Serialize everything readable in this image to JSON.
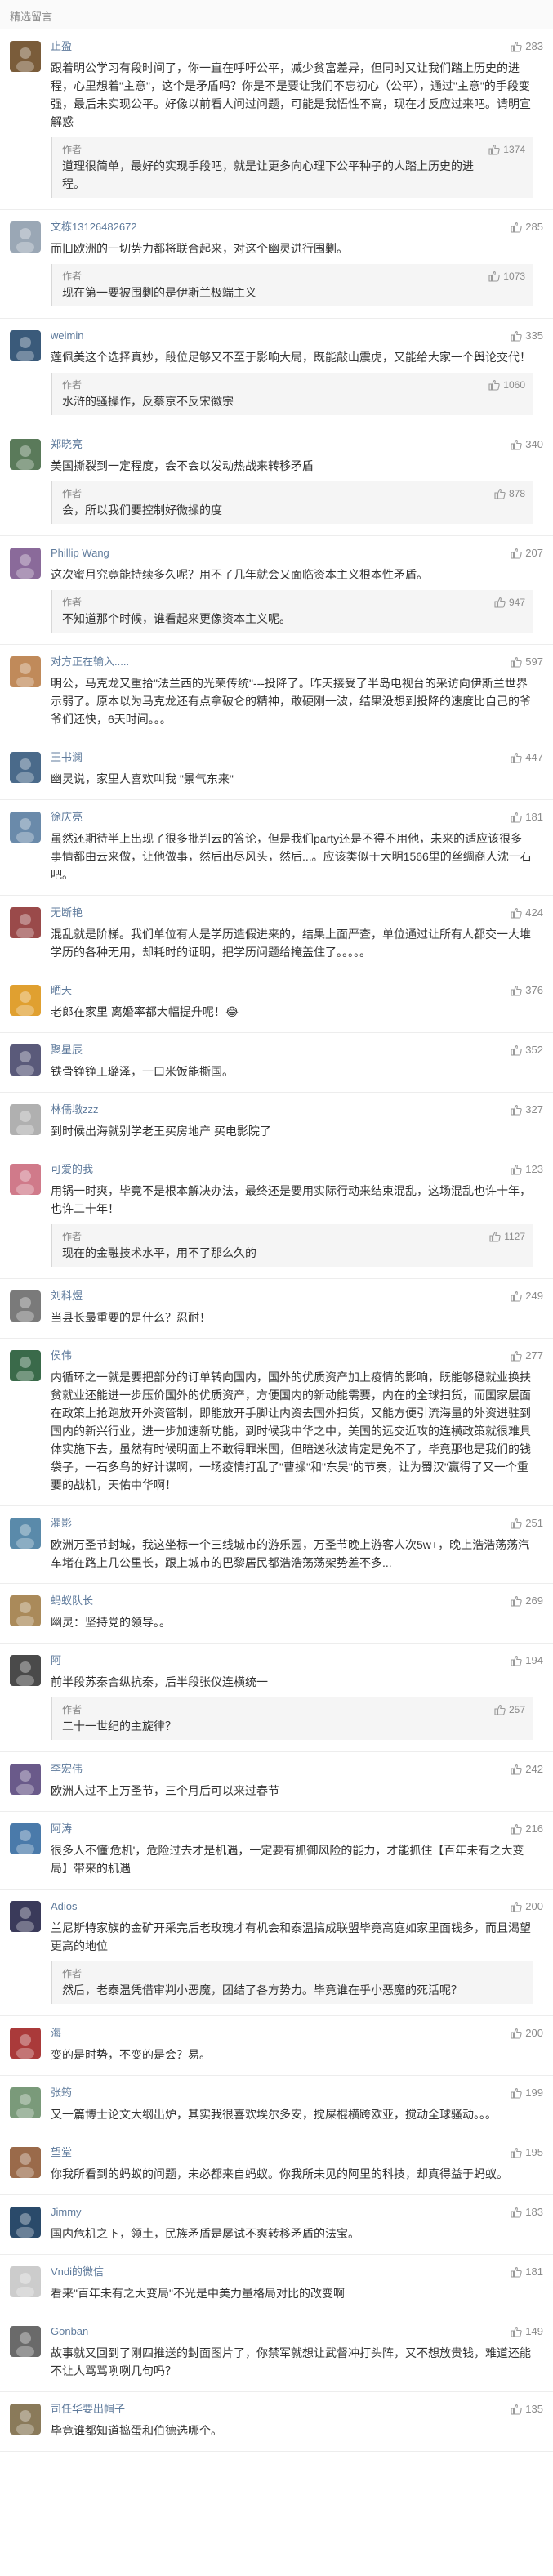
{
  "section_title": "精选留言",
  "author_label": "作者",
  "comments": [
    {
      "name": "止盈",
      "likes": "283",
      "avatar_color": "#7a5c3a",
      "text": "跟着明公学习有段时间了，你一直在呼吁公平，减少贫富差异，但同时又让我们踏上历史的进程，心里想着\"主意\"，这个是矛盾吗？你是不是要让我们不忘初心（公平），通过\"主意\"的手段变强，最后未实现公平。好像以前看人问过问题，可能是我悟性不高，现在才反应过来吧。请明宣解惑",
      "reply": {
        "text": "道理很简单，最好的实现手段吧，就是让更多向心理下公平种子的人踏上历史的进程。",
        "likes": "1374"
      }
    },
    {
      "name": "文栋13126482672",
      "likes": "285",
      "avatar_color": "#9aa7b5",
      "text": "而旧欧洲的一切势力都将联合起来，对这个幽灵进行围剿。",
      "reply": {
        "text": "现在第一要被围剿的是伊斯兰极端主义",
        "likes": "1073"
      }
    },
    {
      "name": "weimin",
      "likes": "335",
      "avatar_color": "#3a5a7a",
      "text": "莲佩美这个选择真妙，段位足够又不至于影响大局，既能敲山震虎，又能给大家一个舆论交代！",
      "reply": {
        "text": "水浒的骚操作，反蔡京不反宋徽宗",
        "likes": "1060"
      }
    },
    {
      "name": "郑晓亮",
      "likes": "340",
      "avatar_color": "#5a7a5a",
      "text": "美国撕裂到一定程度，会不会以发动热战来转移矛盾",
      "reply": {
        "text": "会，所以我们要控制好微操的度",
        "likes": "878"
      }
    },
    {
      "name": "Phillip Wang",
      "likes": "207",
      "avatar_color": "#8a6a9a",
      "text": "这次蜜月究竟能持续多久呢？用不了几年就会又面临资本主义根本性矛盾。",
      "reply": {
        "text": "不知道那个时候，谁看起来更像资本主义呢。",
        "likes": "947"
      }
    },
    {
      "name": "对方正在输入.....",
      "likes": "597",
      "avatar_color": "#c08a5a",
      "text": "明公，马克龙又重拾\"法兰西的光荣传统\"---投降了。昨天接受了半岛电视台的采访向伊斯兰世界示弱了。原本以为马克龙还有点拿破仑的精神，敢硬刚一波，结果没想到投降的速度比自己的爷爷们还快，6天时间。。。",
      "reply": null
    },
    {
      "name": "王书澜",
      "likes": "447",
      "avatar_color": "#4a6a8a",
      "text": "幽灵说，家里人喜欢叫我 \"景气东来\"",
      "reply": null
    },
    {
      "name": "徐庆亮",
      "likes": "181",
      "avatar_color": "#6a8aaa",
      "text": "虽然还期待半上出现了很多批判云的答论，但是我们party还是不得不用他，未来的适应该很多事情都由云来做，让他做事，然后出尽风头，然后...。应该类似于大明1566里的丝绸商人沈一石吧。",
      "reply": null
    },
    {
      "name": "无断艳",
      "likes": "424",
      "avatar_color": "#9a4a4a",
      "text": "混乱就是阶梯。我们单位有人是学历造假进来的，结果上面严查，单位通过让所有人都交一大堆学历的各种无用，却耗时的证明，把学历问题给掩盖住了。。。。。",
      "reply": null
    },
    {
      "name": "晒天",
      "likes": "376",
      "avatar_color": "#e0a030",
      "text": "老郎在家里 离婚率都大幅提升呢！😂",
      "reply": null
    },
    {
      "name": "聚星辰",
      "likes": "352",
      "avatar_color": "#5a5a7a",
      "text": "铁骨铮铮王璐泽，一口米饭能撕国。",
      "reply": null
    },
    {
      "name": "林儒墩zzz",
      "likes": "327",
      "avatar_color": "#b0b0b0",
      "text": "到时候出海就别学老王买房地产 买电影院了",
      "reply": null
    },
    {
      "name": "可爱的我",
      "likes": "123",
      "avatar_color": "#d07a8a",
      "text": "用锅一时爽，毕竟不是根本解决办法，最终还是要用实际行动来结束混乱，这场混乱也许十年，也许二十年！",
      "reply": {
        "text": "现在的金融技术水平，用不了那么久的",
        "likes": "1127"
      }
    },
    {
      "name": "刘科煜",
      "likes": "249",
      "avatar_color": "#7a7a7a",
      "text": "当县长最重要的是什么？忍耐！",
      "reply": null
    },
    {
      "name": "侯伟",
      "likes": "277",
      "avatar_color": "#3a6a4a",
      "text": "内循环之一就是要把部分的订单转向国内，国外的优质资产加上疫情的影响，既能够稳就业换扶贫就业还能进一步压价国外的优质资产，方便国内的新动能需要，内在的全球扫货，而国家层面在政策上抢跑放开外资管制，即能放开手脚让内资去国外扫货，又能方便引流海量的外资进驻到国内的新兴行业，进一步加速新功能，到时候我中华之中，美国的远交近攻的连横政策就很难具体实施下去，虽然有时候明面上不敢得罪米国，但暗送秋波肯定是免不了，毕竟那也是我们的钱袋子，一石多鸟的好计谋啊，一场疫情打乱了\"曹操\"和\"东吴\"的节奏，让为蜀汉\"赢得了又一个重要的战机，天佑中华啊！",
      "reply": null
    },
    {
      "name": "灈影",
      "likes": "251",
      "avatar_color": "#5a8aaa",
      "text": "欧洲万圣节封城，我这坐标一个三线城市的游乐园，万圣节晚上游客人次5w+，晚上浩浩荡荡汽车堵在路上几公里长，跟上城市的巴黎居民都浩浩荡荡架势差不多...",
      "reply": null
    },
    {
      "name": "蚂蚁队长",
      "likes": "269",
      "avatar_color": "#aa8a5a",
      "text": "幽灵：坚持党的领导。。",
      "reply": null
    },
    {
      "name": "阿",
      "likes": "194",
      "avatar_color": "#4a4a4a",
      "text": "前半段苏秦合纵抗秦，后半段张仪连横统一",
      "reply": {
        "text": "二十一世纪的主旋律？",
        "likes": "257"
      }
    },
    {
      "name": "李宏伟",
      "likes": "242",
      "avatar_color": "#6a5a8a",
      "text": "欧洲人过不上万圣节，三个月后可以来过春节",
      "reply": null
    },
    {
      "name": "阿涛",
      "likes": "216",
      "avatar_color": "#4a7aaa",
      "text": "很多人不懂'危机'，危险过去才是机遇，一定要有抓御风险的能力，才能抓住【百年未有之大变局】带来的机遇",
      "reply": null
    },
    {
      "name": "Adios",
      "likes": "200",
      "avatar_color": "#3a3a5a",
      "text": "兰尼斯特家族的金矿开采完后老玫瑰才有机会和泰温搞成联盟毕竟高庭如家里面钱多，而且渴望更高的地位",
      "reply": {
        "text": "然后，老泰温凭借审判小恶魔，团结了各方势力。毕竟谁在乎小恶魔的死活呢？",
        "likes": null
      }
    },
    {
      "name": "海",
      "likes": "200",
      "avatar_color": "#aa3a3a",
      "text": "变的是时势，不变的是会？易。",
      "reply": null
    },
    {
      "name": "张筠",
      "likes": "199",
      "avatar_color": "#7a9a7a",
      "text": "又一篇博士论文大纲出炉，其实我很喜欢埃尔多安，搅屎棍横跨欧亚，搅动全球骚动。。。",
      "reply": null
    },
    {
      "name": "望堂",
      "likes": "195",
      "avatar_color": "#9a6a4a",
      "text": "你我所看到的蚂蚁的问题，未必都来自蚂蚁。你我所未见的阿里的科技，却真得益于蚂蚁。",
      "reply": null
    },
    {
      "name": "Jimmy",
      "likes": "183",
      "avatar_color": "#2a4a6a",
      "text": "国内危机之下，领土，民族矛盾是屡试不爽转移矛盾的法宝。",
      "reply": null
    },
    {
      "name": "Vndi的微信",
      "likes": "181",
      "avatar_color": "#cccccc",
      "text": "看来\"百年未有之大变局\"不光是中美力量格局对比的改变啊",
      "reply": null
    },
    {
      "name": "Gonban",
      "likes": "149",
      "avatar_color": "#6a6a6a",
      "text": "故事就又回到了刚四推送的封面图片了，你禁军就想让武督冲打头阵，又不想放贵钱，难道还能不让人骂骂咧咧几句吗？",
      "reply": null
    },
    {
      "name": "司任华要出帽子",
      "likes": "135",
      "avatar_color": "#8a7a5a",
      "text": "毕竟谁都知道捣蛋和伯德选哪个。",
      "reply": null
    }
  ]
}
